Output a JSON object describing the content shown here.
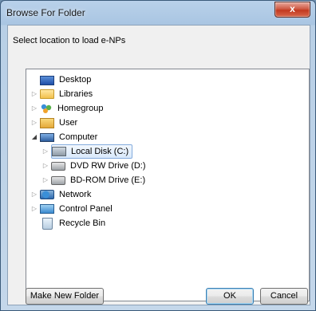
{
  "window": {
    "title": "Browse For Folder",
    "close_glyph": "x"
  },
  "instruction": "Select location to load e-NPs",
  "tree": {
    "items": [
      {
        "label": "Desktop",
        "icon": "desktop-icon",
        "expander": ""
      },
      {
        "label": "Libraries",
        "icon": "libraries-icon",
        "expander": "▷"
      },
      {
        "label": "Homegroup",
        "icon": "homegroup-icon",
        "expander": "▷"
      },
      {
        "label": "User",
        "icon": "user-folder-icon",
        "expander": "▷"
      },
      {
        "label": "Computer",
        "icon": "computer-icon",
        "expander": "◢"
      },
      {
        "label": "Local Disk (C:)",
        "icon": "local-disk-icon",
        "expander": "▷",
        "selected": true
      },
      {
        "label": "DVD RW Drive (D:)",
        "icon": "dvd-drive-icon",
        "expander": "▷"
      },
      {
        "label": "BD-ROM Drive (E:)",
        "icon": "bd-drive-icon",
        "expander": "▷"
      },
      {
        "label": "Network",
        "icon": "network-icon",
        "expander": "▷"
      },
      {
        "label": "Control Panel",
        "icon": "control-panel-icon",
        "expander": "▷"
      },
      {
        "label": "Recycle Bin",
        "icon": "recycle-bin-icon",
        "expander": ""
      }
    ]
  },
  "buttons": {
    "make_new_folder": "Make New Folder",
    "ok": "OK",
    "cancel": "Cancel"
  }
}
